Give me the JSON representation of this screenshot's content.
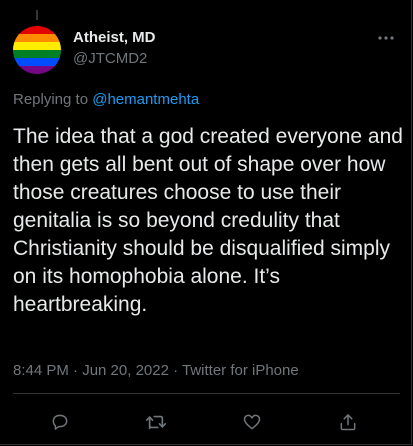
{
  "tweet": {
    "author": {
      "display_name": "Atheist, MD",
      "handle": "@JTCMD2",
      "avatar": "rainbow-flag-avatar"
    },
    "replying_to": {
      "prefix": "Replying to",
      "mention": "@hemantmehta"
    },
    "text": "The idea that a god created everyone and then gets all bent out of shape over how those creatures choose to use their genitalia is so beyond credulity that Christianity should be disqualified simply on its homophobia alone. It’s heartbreaking.",
    "meta": "8:44 PM · Jun 20, 2022 · Twitter for iPhone",
    "more_icon": "more-horizontal-icon",
    "actions": [
      {
        "name": "reply",
        "icon": "reply-icon"
      },
      {
        "name": "retweet",
        "icon": "retweet-icon"
      },
      {
        "name": "like",
        "icon": "heart-icon"
      },
      {
        "name": "share",
        "icon": "share-icon"
      }
    ]
  },
  "colors": {
    "background": "#000000",
    "text": "#e7e9ea",
    "secondary": "#71767b",
    "link": "#1d9bf0",
    "border": "#2f3336"
  }
}
